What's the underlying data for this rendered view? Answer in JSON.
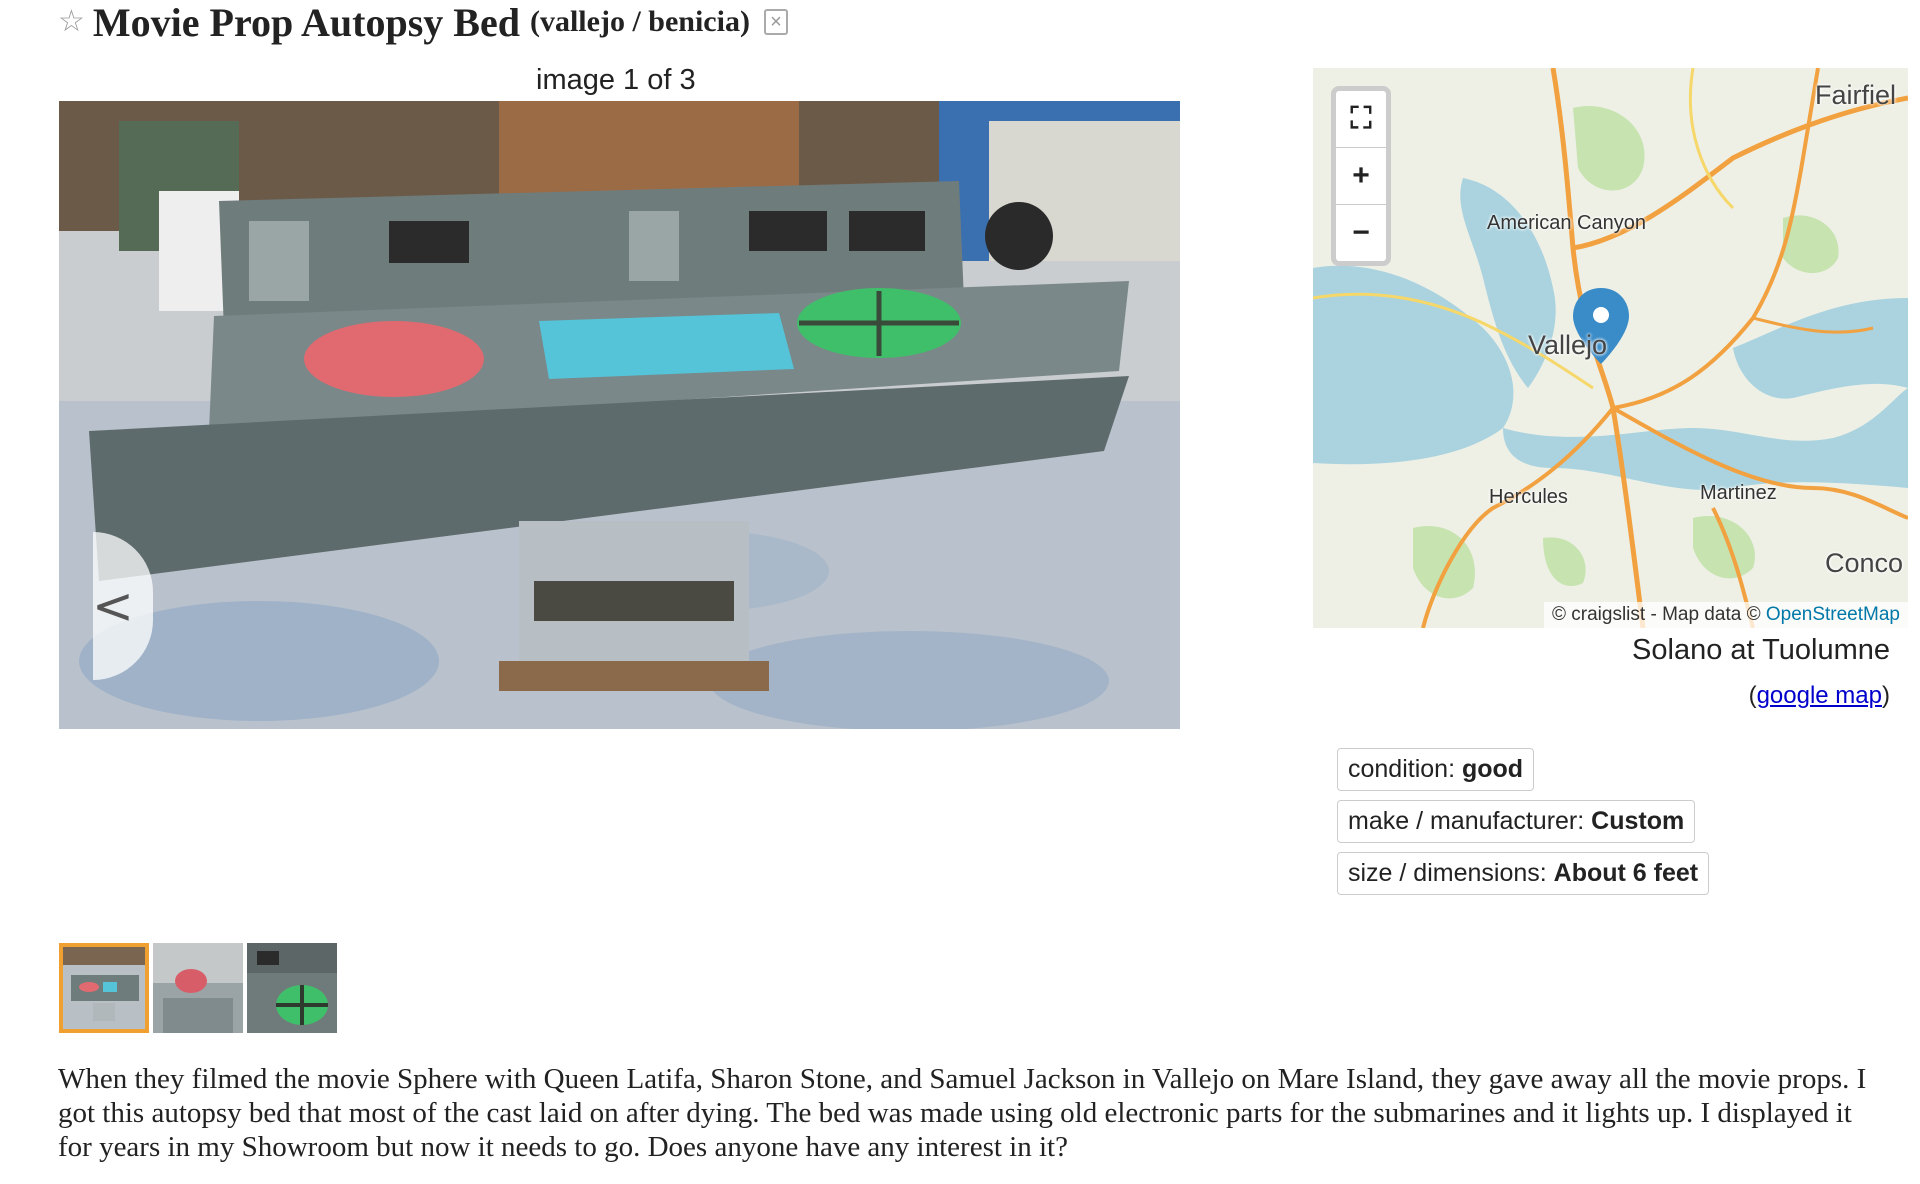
{
  "header": {
    "favorite_icon": "star-icon",
    "title": "Movie Prop Autopsy Bed",
    "location": "(vallejo / benicia)",
    "hide_icon": "hide-x-icon"
  },
  "gallery": {
    "counter": "image 1 of 3",
    "prev_label": "<",
    "next_label": ">",
    "thumbnails": [
      {
        "name": "thumb-1",
        "active": true
      },
      {
        "name": "thumb-2",
        "active": false
      },
      {
        "name": "thumb-3",
        "active": false
      }
    ]
  },
  "map": {
    "controls": {
      "fullscreen_icon": "fullscreen-icon",
      "zoom_in": "+",
      "zoom_out": "−"
    },
    "labels": {
      "fairfield": "Fairfiel",
      "american_canyon": "American Canyon",
      "vallejo": "Vallejo",
      "hercules": "Hercules",
      "martinez": "Martinez",
      "concord": "Conco"
    },
    "attribution_prefix": "© craigslist - Map data ©",
    "attribution_link": "OpenStreetMap",
    "marker_icon": "map-pin-icon"
  },
  "location": {
    "street": "Solano at Tuolumne",
    "google_map_open": "(",
    "google_map_link": "google map",
    "google_map_close": ")"
  },
  "attributes": [
    {
      "label": "condition:",
      "value": "good"
    },
    {
      "label": "make / manufacturer:",
      "value": "Custom"
    },
    {
      "label": "size / dimensions:",
      "value": "About 6 feet"
    }
  ],
  "body": "When they filmed the movie Sphere with Queen Latifa, Sharon Stone, and Samuel Jackson in Vallejo on Mare Island, they gave away all the movie props. I got this autopsy bed that most of the cast laid on after dying. The bed was made using old electronic parts for the submarines and it lights up. I displayed it for years in my Showroom but now it needs to go. Does anyone have any interest in it?",
  "colors": {
    "thumb_active_border": "#f0a030",
    "link": "#0000cc",
    "osm_link": "#0078a8"
  }
}
